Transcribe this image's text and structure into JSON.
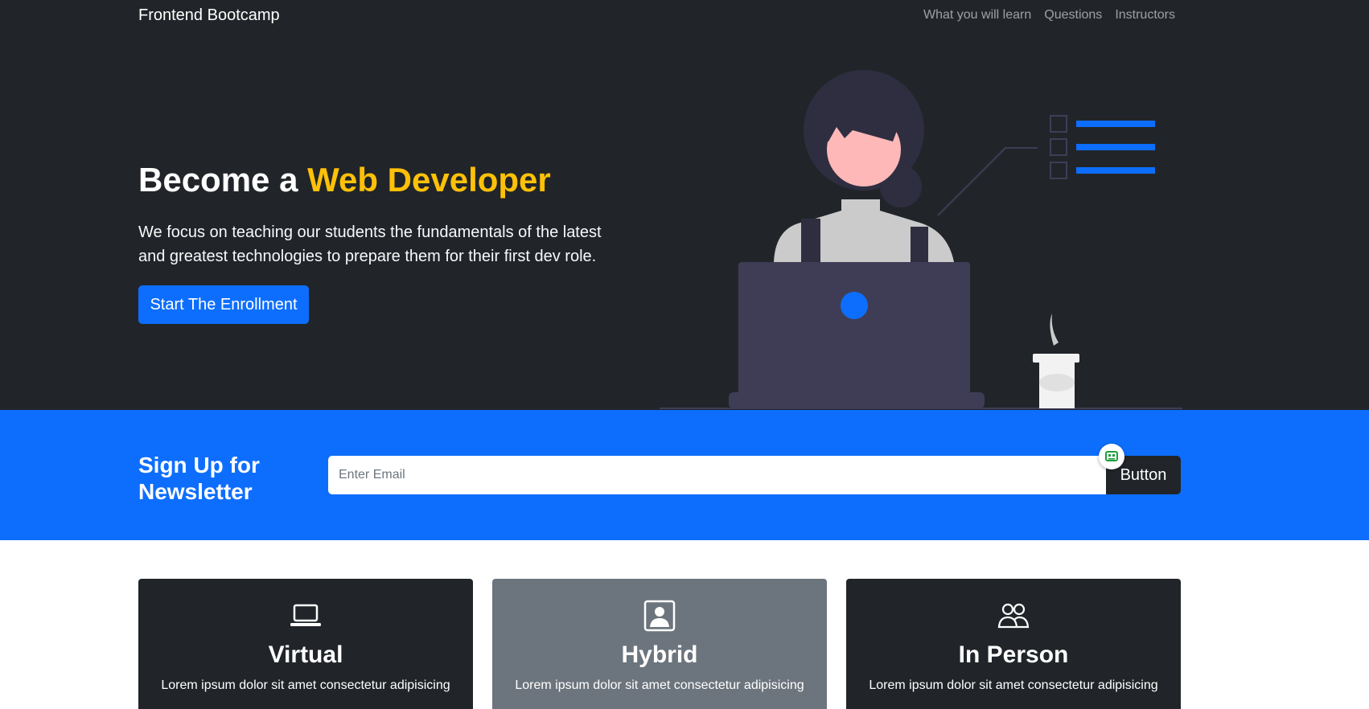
{
  "navbar": {
    "brand": "Frontend Bootcamp",
    "links": [
      "What you will learn",
      "Questions",
      "Instructors"
    ]
  },
  "hero": {
    "title_prefix": "Become a ",
    "title_accent": "Web Developer",
    "description": "We focus on teaching our students the fundamentals of the latest and greatest technologies to prepare them for their first dev role.",
    "cta_label": "Start The Enrollment"
  },
  "newsletter": {
    "title_line1": "Sign Up for",
    "title_line2": "Newsletter",
    "email_placeholder": "Enter Email",
    "button_label": "Button"
  },
  "cards": [
    {
      "title": "Virtual",
      "text": "Lorem ipsum dolor sit amet consectetur adipisicing",
      "icon": "laptop-icon"
    },
    {
      "title": "Hybrid",
      "text": "Lorem ipsum dolor sit amet consectetur adipisicing",
      "icon": "person-badge-icon"
    },
    {
      "title": "In Person",
      "text": "Lorem ipsum dolor sit amet consectetur adipisicing",
      "icon": "people-icon"
    }
  ],
  "colors": {
    "dark": "#212529",
    "primary": "#0d6efd",
    "accent": "#ffc107",
    "secondary": "#6c757d"
  }
}
